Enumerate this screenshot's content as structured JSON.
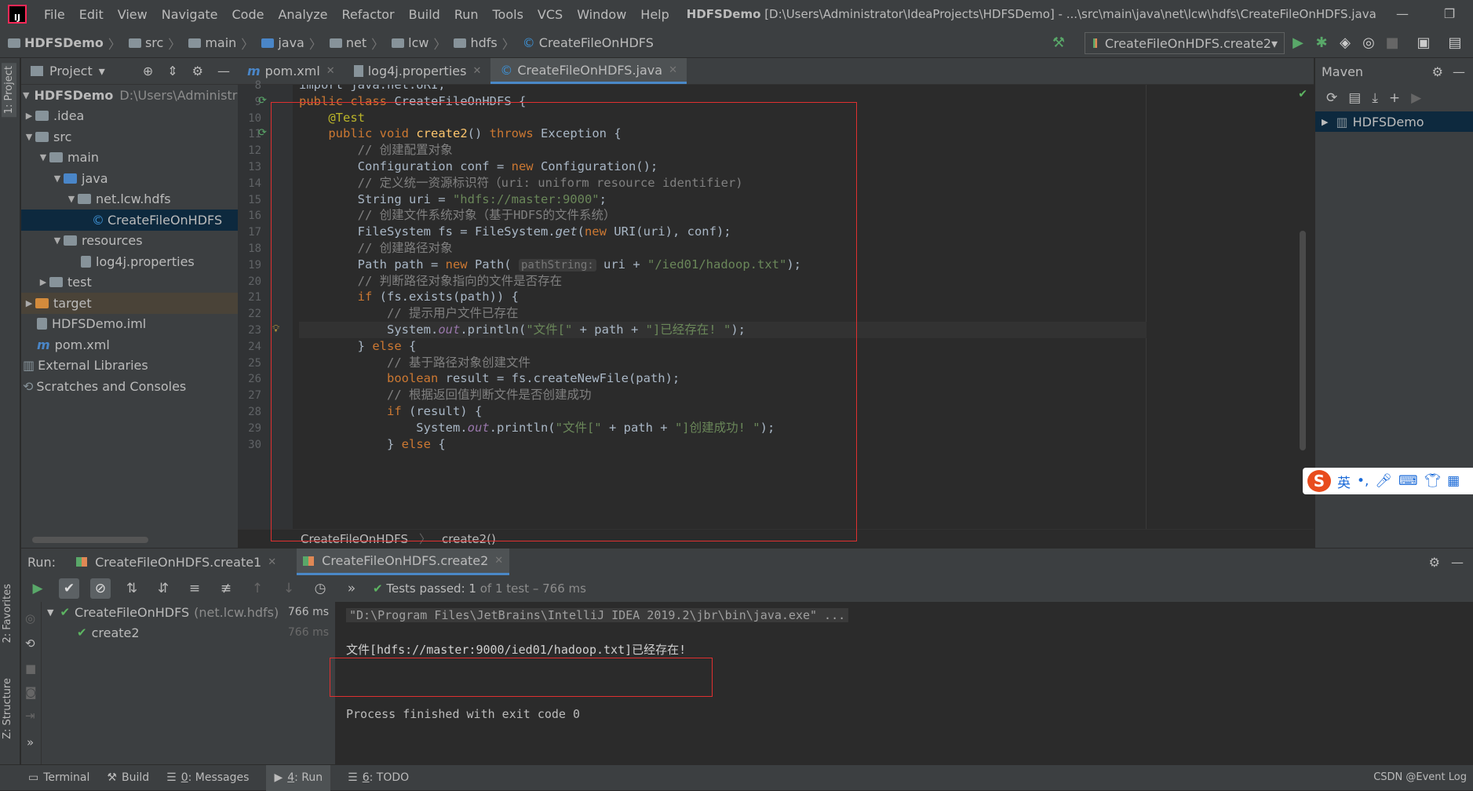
{
  "menu": [
    "File",
    "Edit",
    "View",
    "Navigate",
    "Code",
    "Analyze",
    "Refactor",
    "Build",
    "Run",
    "Tools",
    "VCS",
    "Window",
    "Help"
  ],
  "window_title_project": "HDFSDemo",
  "window_title_path": "[D:\\Users\\Administrator\\IdeaProjects\\HDFSDemo] - ...\\src\\main\\java\\net\\lcw\\hdfs\\CreateFileOnHDFS.java",
  "breadcrumbs": [
    "HDFSDemo",
    "src",
    "main",
    "java",
    "net",
    "lcw",
    "hdfs",
    "CreateFileOnHDFS"
  ],
  "run_config": "CreateFileOnHDFS.create2",
  "project_panel": {
    "title": "Project",
    "tree": [
      {
        "label": "HDFSDemo",
        "extra": "D:\\Users\\Administrato",
        "level": 0,
        "arrow": "▼"
      },
      {
        "label": ".idea",
        "level": 1,
        "arrow": "▶"
      },
      {
        "label": "src",
        "level": 1,
        "arrow": "▼"
      },
      {
        "label": "main",
        "level": 2,
        "arrow": "▼"
      },
      {
        "label": "java",
        "level": 3,
        "arrow": "▼"
      },
      {
        "label": "net.lcw.hdfs",
        "level": 4,
        "arrow": "▼"
      },
      {
        "label": "CreateFileOnHDFS",
        "level": 5,
        "arrow": ""
      },
      {
        "label": "resources",
        "level": 3,
        "arrow": "▼"
      },
      {
        "label": "log4j.properties",
        "level": 4,
        "arrow": ""
      },
      {
        "label": "test",
        "level": 2,
        "arrow": "▶"
      },
      {
        "label": "target",
        "level": 1,
        "arrow": "▶"
      },
      {
        "label": "HDFSDemo.iml",
        "level": 1,
        "arrow": ""
      },
      {
        "label": "pom.xml",
        "level": 1,
        "arrow": ""
      },
      {
        "label": "External Libraries",
        "level": 0,
        "arrow": ""
      },
      {
        "label": "Scratches and Consoles",
        "level": 0,
        "arrow": ""
      }
    ]
  },
  "editor_tabs": [
    "pom.xml",
    "log4j.properties",
    "CreateFileOnHDFS.java"
  ],
  "code_lines": [
    {
      "n": "8",
      "text": "import java.net.URI;"
    },
    {
      "n": "9",
      "text": "public class CreateFileOnHDFS {"
    },
    {
      "n": "10",
      "text": "    @Test"
    },
    {
      "n": "11",
      "text": "    public void create2() throws Exception {"
    },
    {
      "n": "12",
      "text": "        // 创建配置对象"
    },
    {
      "n": "13",
      "text": "        Configuration conf = new Configuration();"
    },
    {
      "n": "14",
      "text": "        // 定义统一资源标识符（uri: uniform resource identifier)"
    },
    {
      "n": "15",
      "text": "        String uri = \"hdfs://master:9000\";"
    },
    {
      "n": "16",
      "text": "        // 创建文件系统对象（基于HDFS的文件系统）"
    },
    {
      "n": "17",
      "text": "        FileSystem fs = FileSystem.get(new URI(uri), conf);"
    },
    {
      "n": "18",
      "text": "        // 创建路径对象"
    },
    {
      "n": "19",
      "text": "        Path path = new Path( pathString: uri + \"/ied01/hadoop.txt\");"
    },
    {
      "n": "20",
      "text": "        // 判断路径对象指向的文件是否存在"
    },
    {
      "n": "21",
      "text": "        if (fs.exists(path)) {"
    },
    {
      "n": "22",
      "text": "            // 提示用户文件已存在"
    },
    {
      "n": "23",
      "text": "            System.out.println(\"文件[\" + path + \"]已经存在! \");"
    },
    {
      "n": "24",
      "text": "        } else {"
    },
    {
      "n": "25",
      "text": "            // 基于路径对象创建文件"
    },
    {
      "n": "26",
      "text": "            boolean result = fs.createNewFile(path);"
    },
    {
      "n": "27",
      "text": "            // 根据返回值判断文件是否创建成功"
    },
    {
      "n": "28",
      "text": "            if (result) {"
    },
    {
      "n": "29",
      "text": "                System.out.println(\"文件[\" + path + \"]创建成功! \");"
    },
    {
      "n": "30",
      "text": "            } else {"
    }
  ],
  "editor_breadcrumbs": [
    "CreateFileOnHDFS",
    "create2()"
  ],
  "maven": {
    "title": "Maven",
    "project": "HDFSDemo"
  },
  "ime": {
    "lang": "英",
    "punct": "•,"
  },
  "run_panel": {
    "label": "Run:",
    "tabs": [
      "CreateFileOnHDFS.create1",
      "CreateFileOnHDFS.create2"
    ],
    "status": "Tests passed: 1",
    "status_rest": "of 1 test – 766 ms",
    "tests": [
      {
        "name": "CreateFileOnHDFS",
        "pkg": "(net.lcw.hdfs)",
        "dur": "766 ms"
      },
      {
        "name": "create2",
        "pkg": "",
        "dur": "766 ms"
      }
    ],
    "console": [
      "\"D:\\Program Files\\JetBrains\\IntelliJ IDEA 2019.2\\jbr\\bin\\java.exe\" ...",
      "文件[hdfs://master:9000/ied01/hadoop.txt]已经存在!",
      "Process finished with exit code 0"
    ]
  },
  "left_tabs": [
    "1: Project",
    "2: Favorites",
    "Z: Structure"
  ],
  "statusbar": [
    {
      "key": "",
      "label": "Terminal"
    },
    {
      "key": "",
      "label": "Build"
    },
    {
      "key": "0",
      "label": ": Messages"
    },
    {
      "key": "4",
      "label": ": Run"
    },
    {
      "key": "6",
      "label": ": TODO"
    }
  ],
  "watermark": "CSDN @Event Log"
}
